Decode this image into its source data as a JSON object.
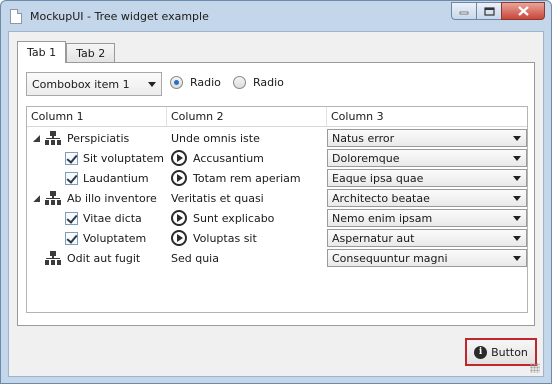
{
  "window": {
    "title": "MockupUI - Tree widget example"
  },
  "tabs": [
    {
      "label": "Tab 1"
    },
    {
      "label": "Tab 2"
    }
  ],
  "combo": {
    "value": "Combobox item 1"
  },
  "radios": [
    {
      "label": "Radio",
      "checked": true
    },
    {
      "label": "Radio",
      "checked": false
    }
  ],
  "tree": {
    "columns": [
      "Column 1",
      "Column 2",
      "Column 3"
    ],
    "rows": [
      {
        "c1": "Perspiciatis",
        "c2": "Unde omnis iste",
        "c3": "Natus error"
      },
      {
        "c1": "Sit voluptatem",
        "c2": "Accusantium",
        "c3": "Doloremque"
      },
      {
        "c1": "Laudantium",
        "c2": "Totam rem aperiam",
        "c3": "Eaque ipsa quae"
      },
      {
        "c1": "Ab illo inventore",
        "c2": "Veritatis et quasi",
        "c3": "Architecto beatae"
      },
      {
        "c1": "Vitae dicta",
        "c2": "Sunt explicabo",
        "c3": "Nemo enim ipsam"
      },
      {
        "c1": "Voluptatem",
        "c2": "Voluptas sit",
        "c3": "Aspernatur aut"
      },
      {
        "c1": "Odit aut fugit",
        "c2": "Sed quia",
        "c3": "Consequuntur magni"
      }
    ]
  },
  "button": {
    "label": "Button",
    "icon": "info-icon"
  }
}
